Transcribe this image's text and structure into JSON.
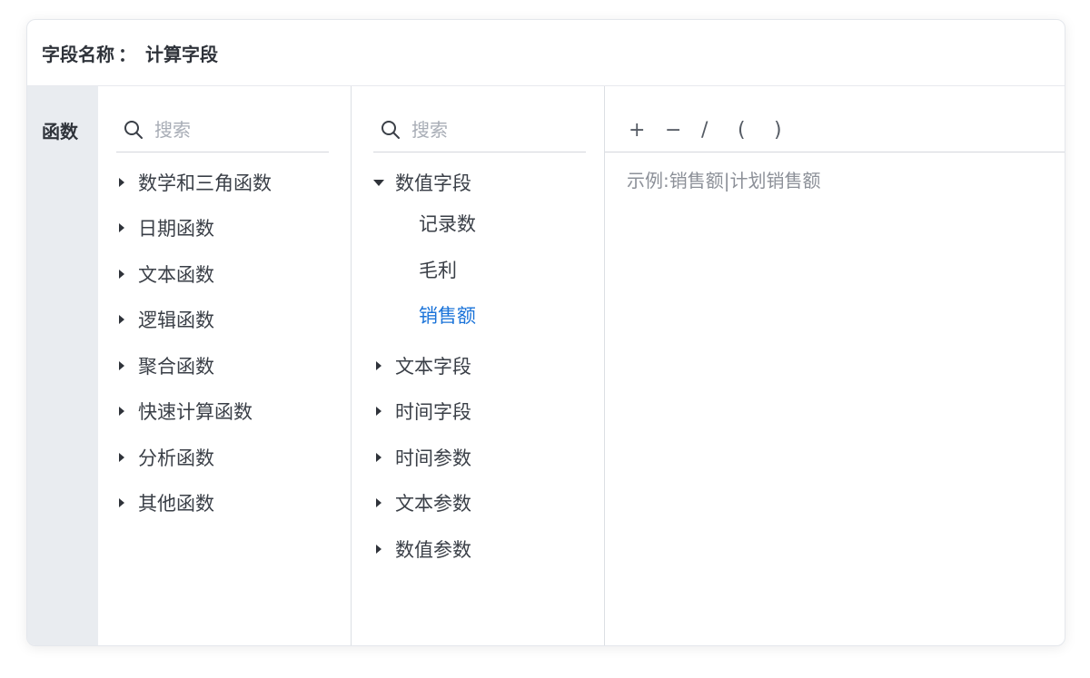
{
  "header": {
    "label": "字段名称",
    "separator": "：",
    "value": "计算字段"
  },
  "category": {
    "label": "函数"
  },
  "functions": {
    "search_placeholder": "搜索",
    "items": [
      "数学和三角函数",
      "日期函数",
      "文本函数",
      "逻辑函数",
      "聚合函数",
      "快速计算函数",
      "分析函数",
      "其他函数"
    ]
  },
  "fields": {
    "search_placeholder": "搜索",
    "expanded_group": "数值字段",
    "children": [
      "记录数",
      "毛利",
      "销售额"
    ],
    "selected_child": "销售额",
    "groups": [
      "文本字段",
      "时间字段",
      "时间参数",
      "文本参数",
      "数值参数"
    ]
  },
  "editor": {
    "operators": [
      "+",
      "−",
      "/",
      "(",
      ")"
    ],
    "example_placeholder": "示例:销售额|计划销售额"
  },
  "colors": {
    "accent": "#1a73d9",
    "sidebar_bg": "#e9ecf0",
    "text": "#3a3f47",
    "placeholder": "#8c9098"
  }
}
